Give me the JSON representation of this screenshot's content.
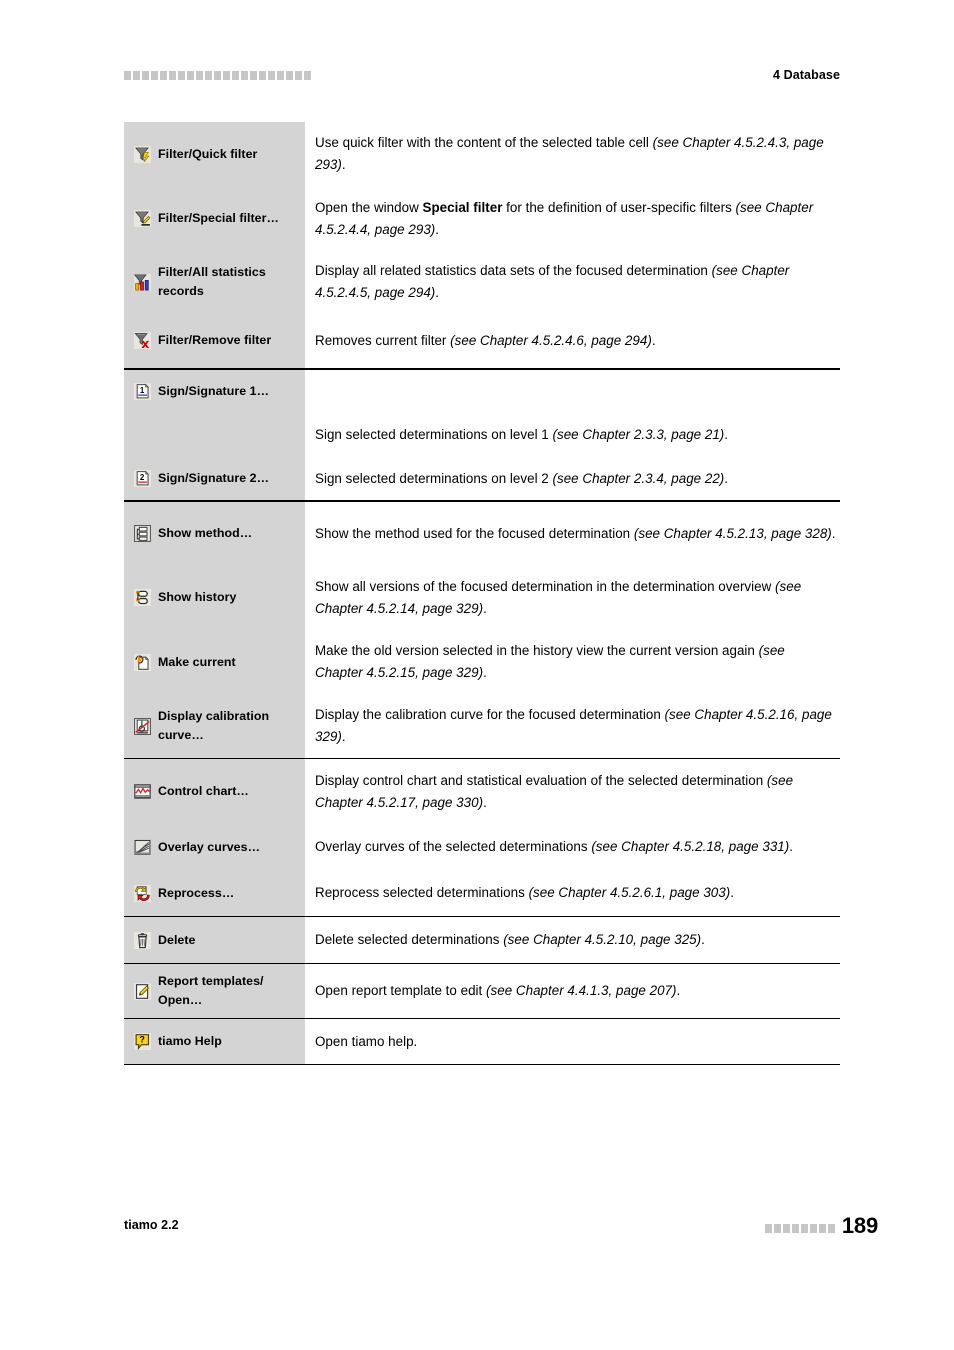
{
  "header": {
    "chapter": "4 Database",
    "rule_squares": 21
  },
  "footer": {
    "product": "tiamo 2.2",
    "page_number": "189",
    "rule_squares": 8
  },
  "colors": {
    "label_column_bg": "#d4d4d4",
    "rule_gray": "#c6c6c6",
    "text": "#000000"
  },
  "table": {
    "groups": [
      {
        "id": "filter-group",
        "rows": [
          {
            "icon": "filter-quick-icon",
            "label": "Filter/Quick filter",
            "desc_plain": "Use quick filter with the content of the selected table cell ",
            "desc_italic": "(see Chapter 4.5.2.4.3, page 293)",
            "desc_tail": "."
          },
          {
            "icon": "filter-special-icon",
            "label": "Filter/Special filter…",
            "desc_plain": "Open the window ",
            "desc_bold": "Special filter",
            "desc_plain2": " for the definition of user-specific filters ",
            "desc_italic": "(see Chapter 4.5.2.4.4, page 293)",
            "desc_tail": "."
          },
          {
            "icon": "filter-statistics-icon",
            "label": "Filter/All statistics records",
            "desc_plain": "Display all related statistics data sets of the focused determination ",
            "desc_italic": "(see Chapter 4.5.2.4.5, page 294)",
            "desc_tail": "."
          },
          {
            "icon": "filter-remove-icon",
            "label": "Filter/Remove filter",
            "desc_plain": "Removes current filter ",
            "desc_italic": "(see Chapter 4.5.2.4.6, page 294)",
            "desc_tail": "."
          }
        ]
      },
      {
        "id": "signature-group",
        "rows": [
          {
            "icon": "signature-1-icon",
            "label": "Sign/Signature 1…",
            "desc_plain": "",
            "desc_italic": "",
            "desc_tail": ""
          },
          {
            "icon": "",
            "label": "",
            "desc_plain": "Sign selected determinations on level 1 ",
            "desc_italic": "(see Chapter 2.3.3, page 21)",
            "desc_tail": "."
          },
          {
            "icon": "signature-2-icon",
            "label": "Sign/Signature 2…",
            "desc_plain": "Sign selected determinations on level 2 ",
            "desc_italic": "(see Chapter 2.3.4, page 22)",
            "desc_tail": "."
          }
        ]
      },
      {
        "id": "method-history-group",
        "rows": [
          {
            "icon": "show-method-icon",
            "label": "Show method…",
            "desc_plain": "Show the method used for the focused determination ",
            "desc_italic": "(see Chapter 4.5.2.13, page 328)",
            "desc_tail": "."
          },
          {
            "icon": "show-history-icon",
            "label": "Show history",
            "desc_plain": "Show all versions of the focused determination in the determination overview ",
            "desc_italic": "(see Chapter 4.5.2.14, page 329)",
            "desc_tail": "."
          },
          {
            "icon": "make-current-icon",
            "label": "Make current",
            "desc_plain": "Make the old version selected in the history view the current version again ",
            "desc_italic": "(see Chapter 4.5.2.15, page 329)",
            "desc_tail": "."
          },
          {
            "icon": "calibration-curve-icon",
            "label": "Display calibration curve…",
            "desc_plain": "Display the calibration curve for the focused determination ",
            "desc_italic": "(see Chapter 4.5.2.16, page 329)",
            "desc_tail": "."
          }
        ]
      },
      {
        "id": "evaluation-group",
        "rows": [
          {
            "icon": "control-chart-icon",
            "label": "Control chart…",
            "desc_plain": "Display control chart and statistical evaluation of the selected determination ",
            "desc_italic": "(see Chapter 4.5.2.17, page 330)",
            "desc_tail": "."
          },
          {
            "icon": "overlay-curves-icon",
            "label": "Overlay curves…",
            "desc_plain": "Overlay curves of the selected determinations ",
            "desc_italic": "(see Chapter 4.5.2.18, page 331)",
            "desc_tail": "."
          },
          {
            "icon": "reprocess-icon",
            "label": "Reprocess…",
            "desc_plain": "Reprocess selected determinations ",
            "desc_italic": "(see Chapter 4.5.2.6.1, page 303)",
            "desc_tail": "."
          }
        ]
      },
      {
        "id": "delete-group",
        "rows": [
          {
            "icon": "delete-icon",
            "label": "Delete",
            "desc_plain": "Delete selected determinations ",
            "desc_italic": "(see Chapter 4.5.2.10, page 325)",
            "desc_tail": "."
          }
        ]
      },
      {
        "id": "report-group",
        "rows": [
          {
            "icon": "report-template-icon",
            "label": "Report templates/ Open…",
            "desc_plain": "Open report template to edit ",
            "desc_italic": "(see Chapter 4.4.1.3, page 207)",
            "desc_tail": "."
          }
        ]
      },
      {
        "id": "help-group",
        "rows": [
          {
            "icon": "tiamo-help-icon",
            "label": "tiamo Help",
            "desc_plain": "Open tiamo help.",
            "desc_italic": "",
            "desc_tail": ""
          }
        ]
      }
    ]
  }
}
